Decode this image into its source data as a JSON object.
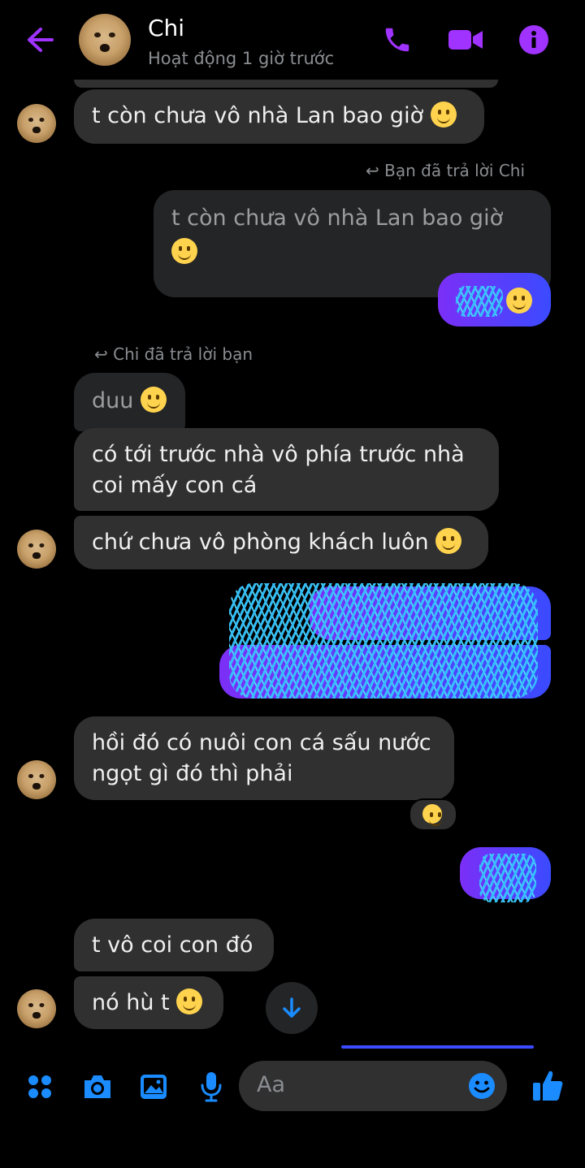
{
  "header": {
    "contact_name": "Chi",
    "status": "Hoạt động 1 giờ trước",
    "icons": [
      "back-arrow-icon",
      "phone-icon",
      "video-icon",
      "info-icon"
    ]
  },
  "messages": {
    "m1": "t còn chưa vô nhà Lan bao giờ",
    "reply_you": "Bạn đã trả lời Chi",
    "quoted1_line1": "t còn chưa vô nhà Lan bao giờ",
    "reply_chi": "Chi đã trả lời bạn",
    "quoted2": "duu",
    "m2_line1": "có tới trước nhà vô phía trước nhà",
    "m2_line2": "coi mấy con cá",
    "m3": "chứ chưa vô phòng khách luôn",
    "m4_line1": "hồi đó có nuôi con cá sấu nước",
    "m4_line2": "ngọt gì đó thì phải",
    "m5": "t vô coi con đó",
    "m6": "nó hù t"
  },
  "composer": {
    "placeholder": "Aa"
  },
  "colors": {
    "accent": "#a033ff",
    "blue": "#1a8cff",
    "bubble": "#303030"
  }
}
